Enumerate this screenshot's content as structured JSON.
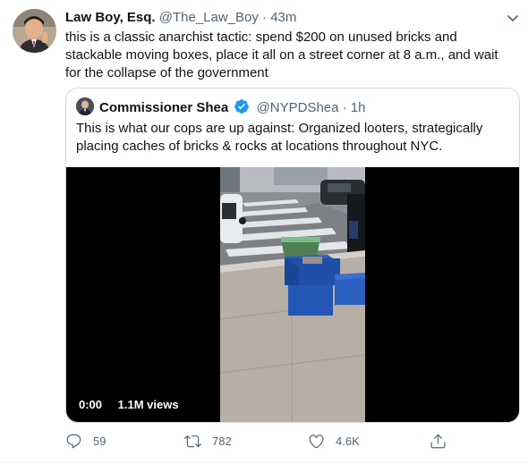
{
  "tweet": {
    "display_name": "Law Boy, Esq.",
    "handle": "@The_Law_Boy",
    "separator": "·",
    "time": "43m",
    "text": "this is a classic anarchist tactic: spend $200 on unused bricks and stackable moving boxes, place it all on a street corner at 8 a.m., and wait for the collapse of the government"
  },
  "quoted": {
    "display_name": "Commissioner Shea",
    "verified": true,
    "handle": "@NYPDShea",
    "separator": "·",
    "time": "1h",
    "text": "This is what our cops are up against: Organized looters, strategically placing caches of bricks & rocks at locations throughout NYC.",
    "video": {
      "time": "0:00",
      "views": "1.1M views"
    }
  },
  "actions": {
    "replies": "59",
    "retweets": "782",
    "likes": "4.6K"
  },
  "colors": {
    "text": "#0f1419",
    "secondary": "#536471",
    "verified": "#1d9bf0",
    "border": "#cfd9de"
  },
  "icons": [
    "chevron-down-icon",
    "verified-badge-icon",
    "reply-icon",
    "retweet-icon",
    "like-icon",
    "share-icon"
  ]
}
